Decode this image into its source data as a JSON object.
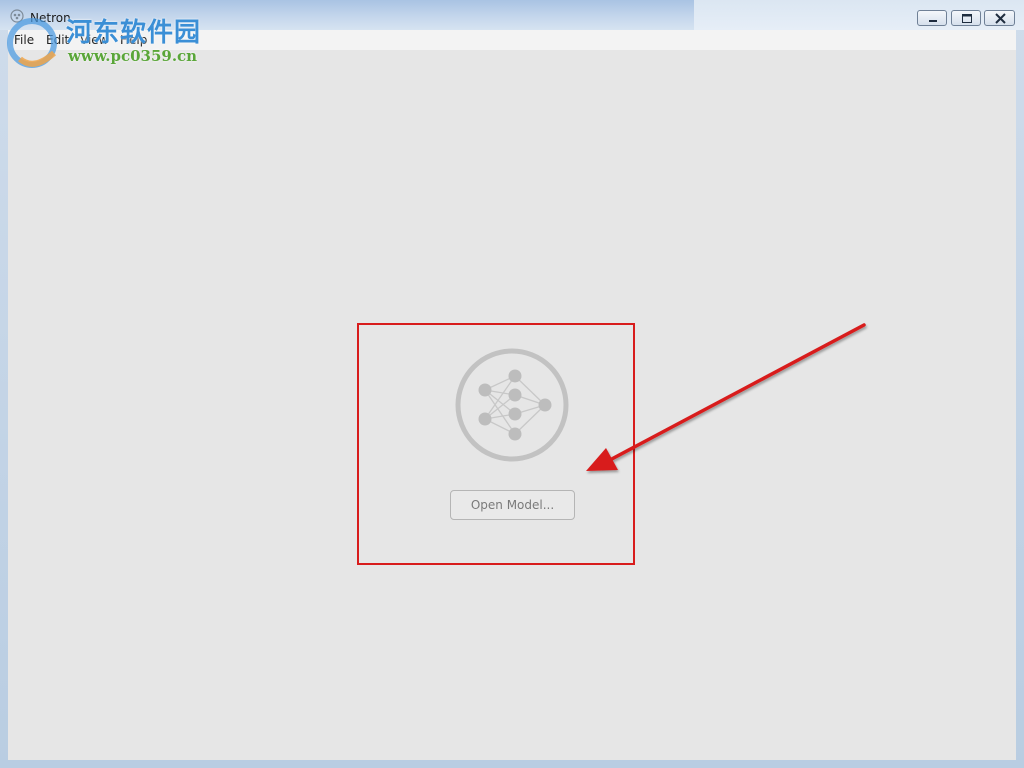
{
  "window": {
    "title": "Netron",
    "icon": "netron-app-icon",
    "controls": [
      "minimize-icon",
      "maximize-icon",
      "close-icon"
    ]
  },
  "menubar": {
    "items": [
      {
        "label": "File"
      },
      {
        "label": "Edit"
      },
      {
        "label": "View"
      },
      {
        "label": "Help"
      }
    ]
  },
  "welcome": {
    "logo_icon": "neural-network-icon",
    "open_model_label": "Open Model..."
  },
  "watermark": {
    "line1": "河东软件园",
    "line2": "www.pc0359.cn"
  },
  "annotation": {
    "box_color": "#d81c1c",
    "arrow_color": "#d81c1c"
  },
  "colors": {
    "client_background": "#e6e6e6",
    "logo_gray": "#c2c2c2"
  }
}
